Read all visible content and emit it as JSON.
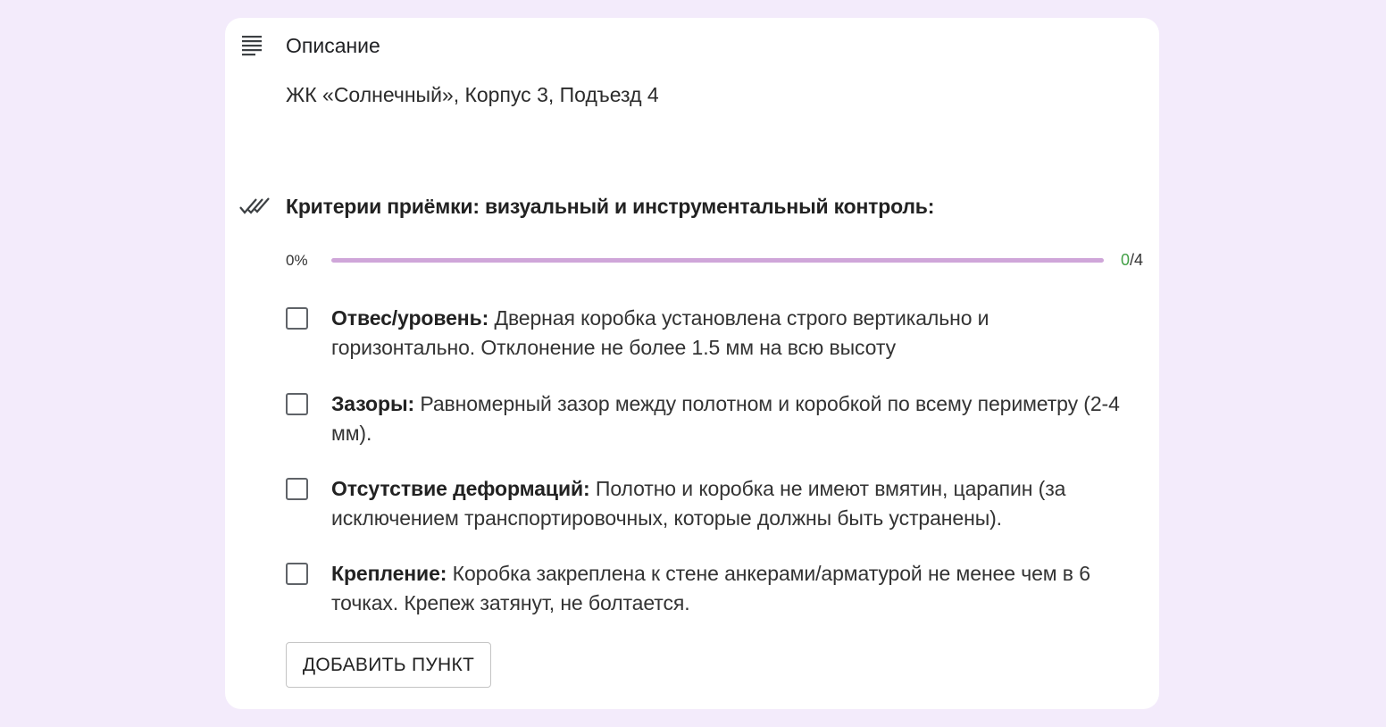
{
  "description": {
    "icon": "notes-icon",
    "title": "Описание",
    "text": "ЖК «Солнечный», Корпус 3, Подъезд 4"
  },
  "checklist": {
    "icon": "double-check-icon",
    "title": "Критерии приёмки: визуальный и инструментальный контроль:",
    "progress": {
      "percent_label": "0%",
      "fraction": 0,
      "done": "0",
      "separator_total": "/4"
    },
    "items": [
      {
        "label": "Отвес/уровень:",
        "text": " Дверная коробка установлена строго вертикально и горизонтально. Отклонение не более 1.5 мм на всю высоту",
        "checked": false
      },
      {
        "label": "Зазоры:",
        "text": " Равномерный зазор между полотном и коробкой по всему периметру (2-4 мм).",
        "checked": false
      },
      {
        "label": "Отсутствие деформаций:",
        "text": " Полотно и коробка не имеют вмятин, царапин (за исключением транспортировочных, которые должны быть устранены).",
        "checked": false
      },
      {
        "label": "Крепление:",
        "text": " Коробка закреплена к стене анкерами/арматурой не менее чем в 6 точках. Крепеж затянут, не болтается.",
        "checked": false
      }
    ],
    "add_button_label": "ДОБАВИТЬ ПУНКТ"
  },
  "colors": {
    "page_background": "#f3ebfb",
    "card_background": "#ffffff",
    "progress_track": "#cfa6d9",
    "progress_done_count": "#43a047",
    "checkbox_border": "#5f6368"
  }
}
